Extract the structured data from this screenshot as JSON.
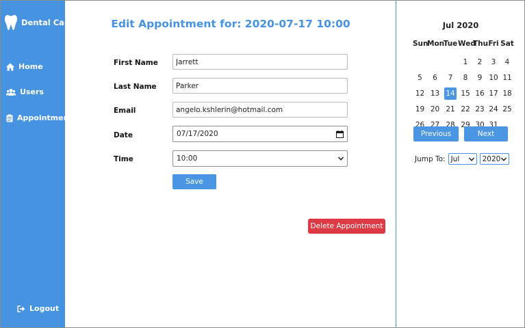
{
  "sidebar": {
    "brand": "Dental Care",
    "items": [
      {
        "label": "Home",
        "icon": "home-icon"
      },
      {
        "label": "Users",
        "icon": "users-icon"
      },
      {
        "label": "Appointments",
        "icon": "clipboard-icon"
      }
    ],
    "logout": "Logout"
  },
  "main": {
    "title": "Edit Appointment for: 2020-07-17 10:00",
    "form": {
      "first_name_label": "First Name",
      "first_name_value": "Jarrett",
      "last_name_label": "Last Name",
      "last_name_value": "Parker",
      "email_label": "Email",
      "email_value": "angelo.kshlerin@hotmail.com",
      "date_label": "Date",
      "date_value": "07/17/2020",
      "time_label": "Time",
      "time_value": "10:00"
    },
    "save_label": "Save",
    "delete_label": "Delete Appointment"
  },
  "calendar": {
    "title": "Jul 2020",
    "weekdays": [
      "Sun",
      "Mon",
      "Tue",
      "Wed",
      "Thu",
      "Fri",
      "Sat"
    ],
    "weeks": [
      [
        "",
        "",
        "",
        "1",
        "2",
        "3",
        "4"
      ],
      [
        "5",
        "6",
        "7",
        "8",
        "9",
        "10",
        "11"
      ],
      [
        "12",
        "13",
        "14",
        "15",
        "16",
        "17",
        "18"
      ],
      [
        "19",
        "20",
        "21",
        "22",
        "23",
        "24",
        "25"
      ],
      [
        "26",
        "27",
        "28",
        "29",
        "30",
        "31",
        ""
      ]
    ],
    "highlighted_day": "14",
    "prev_label": "Previous",
    "next_label": "Next",
    "jump_label": "Jump To:",
    "month_value": "Jul",
    "year_value": "2020"
  },
  "colors": {
    "accent": "#4693e2",
    "danger": "#dc3b45"
  }
}
